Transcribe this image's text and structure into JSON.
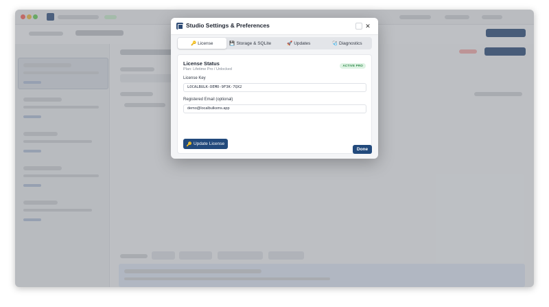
{
  "modal": {
    "title": "Studio Settings & Preferences",
    "tabs": [
      {
        "icon": "🔑",
        "label": "License"
      },
      {
        "icon": "💾",
        "label": "Storage & SQLite"
      },
      {
        "icon": "🚀",
        "label": "Updates"
      },
      {
        "icon": "🩺",
        "label": "Diagnostics"
      }
    ],
    "license": {
      "status_title": "License Status",
      "plan_text": "Plan: Lifetime Pro / Unlocked",
      "badge": "ACTIVE PRO",
      "key_label": "License Key",
      "key_value": "LOCALBULK-DEMO-9F3K-7QX2",
      "email_label": "Registered Email (optional)",
      "email_value": "demo@localbulksms.app",
      "update_button": "Update License"
    },
    "done_button": "Done"
  },
  "colors": {
    "primary": "#224a7c",
    "badge_bg": "#dff3e4",
    "badge_text": "#2f8a4a"
  }
}
